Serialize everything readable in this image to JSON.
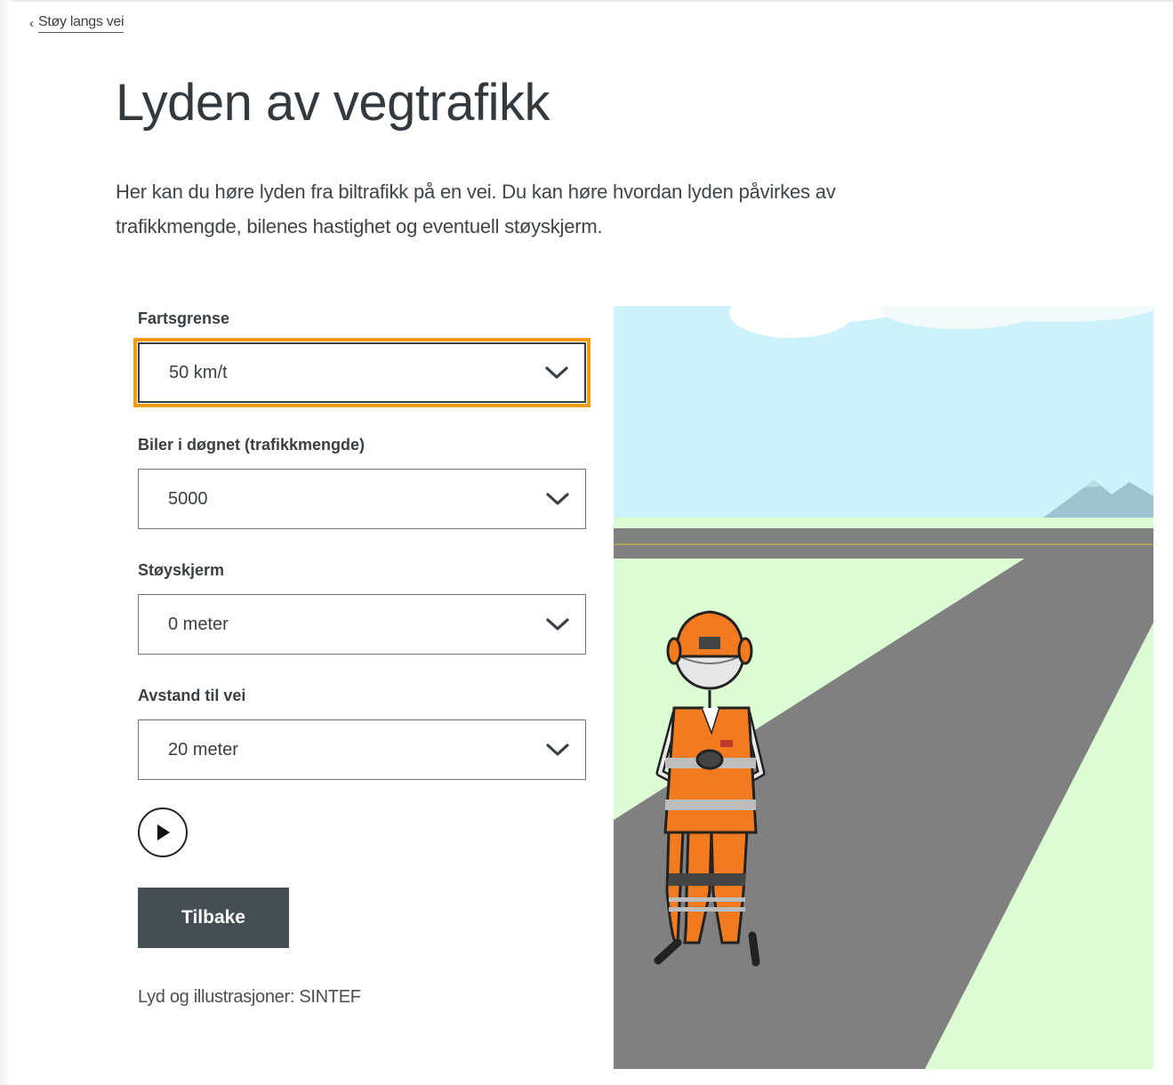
{
  "breadcrumb": {
    "chevron": "‹",
    "label": "Støy langs vei"
  },
  "page": {
    "title": "Lyden av vegtrafikk",
    "intro": "Her kan du høre lyden fra biltrafikk på en vei. Du kan høre hvordan lyden påvirkes av trafikkmengde, bilenes hastighet og eventuell støyskjerm."
  },
  "form": {
    "speed": {
      "label": "Fartsgrense",
      "value": "50 km/t"
    },
    "traffic": {
      "label": "Biler i døgnet (trafikkmengde)",
      "value": "5000"
    },
    "barrier": {
      "label": "Støyskjerm",
      "value": "0 meter"
    },
    "distance": {
      "label": "Avstand til vei",
      "value": "20 meter"
    }
  },
  "player": {
    "icon": "play-icon"
  },
  "actions": {
    "back_label": "Tilbake"
  },
  "credit": "Lyd og illustrasjoner: SINTEF",
  "illustration": {
    "sky_color": "#ccf3fc",
    "grass_color": "#dcfcd4",
    "road_color": "#808080",
    "accent_color": "#f58a1f"
  },
  "colors": {
    "focus_outline": "#f39c12",
    "button_bg": "#444f55",
    "text": "#3a3f44"
  }
}
